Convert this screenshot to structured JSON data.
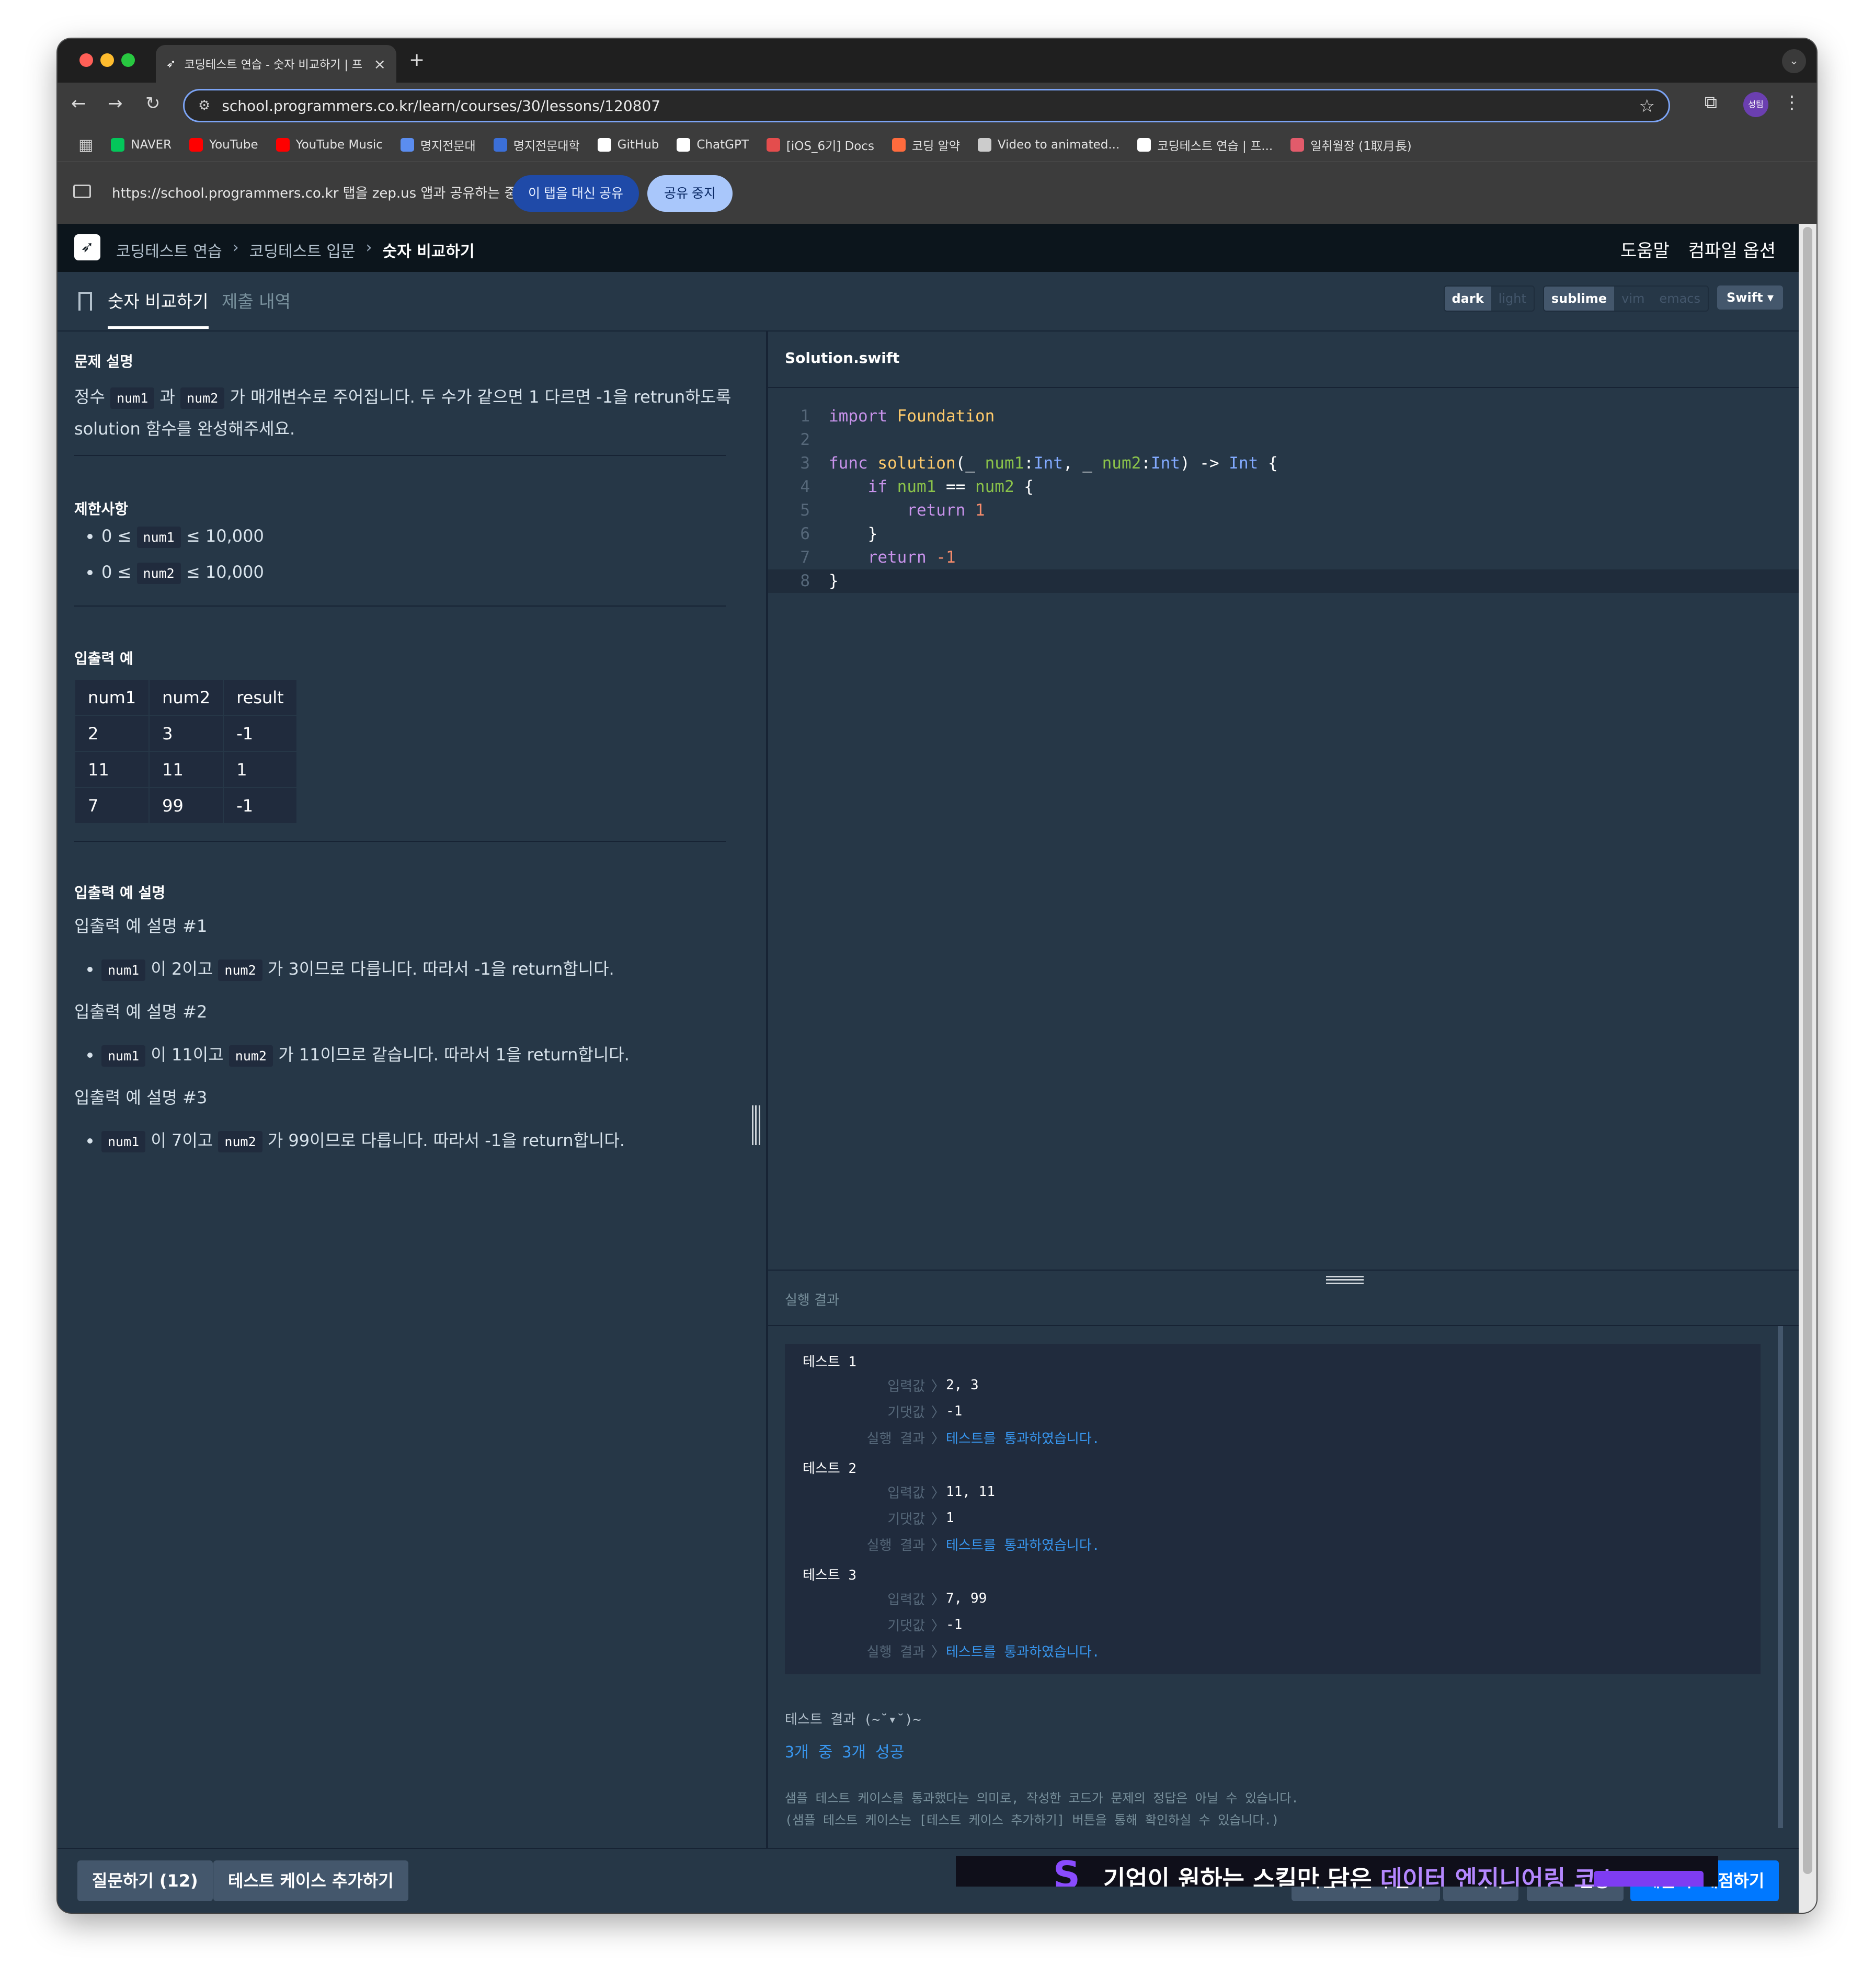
{
  "browser": {
    "tab_title": "코딩테스트 연습 - 숫자 비교하기 | 프",
    "url": "school.programmers.co.kr/learn/courses/30/lessons/120807",
    "profile_label": "성팀",
    "bookmarks": [
      {
        "label": "NAVER",
        "icon": "naver-icon",
        "color": "#03c75a"
      },
      {
        "label": "YouTube",
        "icon": "youtube-icon",
        "color": "#ff0000"
      },
      {
        "label": "YouTube Music",
        "icon": "youtube-music-icon",
        "color": "#ff0000"
      },
      {
        "label": "명지전문대",
        "icon": "doc-icon",
        "color": "#5b8def"
      },
      {
        "label": "명지전문대학",
        "icon": "sparkle-icon",
        "color": "#3b6fd8"
      },
      {
        "label": "GitHub",
        "icon": "github-icon",
        "color": "#ffffff"
      },
      {
        "label": "ChatGPT",
        "icon": "chatgpt-icon",
        "color": "#ffffff"
      },
      {
        "label": "[iOS_6기] Docs",
        "icon": "docs-icon",
        "color": "#e44d4d"
      },
      {
        "label": "코딩 알약",
        "icon": "pill-icon",
        "color": "#ff6b3d"
      },
      {
        "label": "Video to animated...",
        "icon": "video-icon",
        "color": "#cccccc"
      },
      {
        "label": "코딩테스트 연습 | 프...",
        "icon": "programmers-icon",
        "color": "#ffffff"
      },
      {
        "label": "일취월장 (1取月長)",
        "icon": "heart-icon",
        "color": "#e25b6b"
      }
    ]
  },
  "share": {
    "message": "https://school.programmers.co.kr 탭을 zep.us 앱과 공유하는 중",
    "share_this_tab": "이 탭을 대신 공유",
    "stop_sharing": "공유 중지"
  },
  "nav": {
    "breadcrumbs": [
      "코딩테스트 연습",
      "코딩테스트 입문",
      "숫자 비교하기"
    ],
    "help": "도움말",
    "compile_options": "컴파일 옵션"
  },
  "tabs": {
    "problem": "숫자 비교하기",
    "history": "제출 내역"
  },
  "editor_opts": {
    "theme": [
      "dark",
      "light"
    ],
    "keymap": [
      "sublime",
      "vim",
      "emacs"
    ],
    "language": "Swift"
  },
  "problem": {
    "desc_title": "문제 설명",
    "desc_pre": "정수",
    "desc_mid": "과",
    "desc_post": "가 매개변수로 주어집니다. 두 수가 같으면 1 다르면 -1을 retrun하도록",
    "desc_line2": "solution 함수를 완성해주세요.",
    "var1": "num1",
    "var2": "num2",
    "limits_title": "제한사항",
    "limit_lo": "0 ≤",
    "limit_hi": "≤ 10,000",
    "io_title": "입출력 예",
    "io_headers": [
      "num1",
      "num2",
      "result"
    ],
    "io_rows": [
      [
        "2",
        "3",
        "-1"
      ],
      [
        "11",
        "11",
        "1"
      ],
      [
        "7",
        "99",
        "-1"
      ]
    ],
    "explain_title": "입출력 예 설명",
    "explains": [
      {
        "title": "입출력 예 설명 #1",
        "a": "이 2이고",
        "b": "가 3이므로 다릅니다. 따라서 -1을 return합니다."
      },
      {
        "title": "입출력 예 설명 #2",
        "a": "이 11이고",
        "b": "가 11이므로 같습니다. 따라서 1을 return합니다."
      },
      {
        "title": "입출력 예 설명 #3",
        "a": "이 7이고",
        "b": "가 99이므로 다릅니다. 따라서 -1을 return합니다."
      }
    ]
  },
  "editor": {
    "filename": "Solution.swift",
    "line_numbers": [
      "1",
      "2",
      "3",
      "4",
      "5",
      "6",
      "7",
      "8"
    ]
  },
  "results": {
    "title": "실행 결과",
    "label_input": "입력값",
    "label_expected": "기댓값",
    "label_result": "실행 결과",
    "tests": [
      {
        "name": "테스트 1",
        "input": "2, 3",
        "expected": "-1",
        "result": "테스트를 통과하였습니다."
      },
      {
        "name": "테스트 2",
        "input": "11, 11",
        "expected": "1",
        "result": "테스트를 통과하였습니다."
      },
      {
        "name": "테스트 3",
        "input": "7, 99",
        "expected": "-1",
        "result": "테스트를 통과하였습니다."
      }
    ],
    "summary_title": "테스트 결과 (~˘▾˘)~",
    "summary": "3개 중 3개 성공",
    "note1": "샘플 테스트 케이스를 통과했다는 의미로, 작성한 코드가 문제의 정답은 아닐 수 있습니다.",
    "note2": "(샘플 테스트 케이스는 [테스트 케이스 추가하기] 버튼을 통해 확인하실 수 있습니다.)",
    "ad_text_a": "기업이 원하는 스킬만 담은 ",
    "ad_text_b": "데이터 엔지니어링 코스"
  },
  "bottom": {
    "ask": "질문하기 (12)",
    "add_testcase": "테스트 케이스 추가하기",
    "others": "다른 사람의 풀이",
    "reset": "초기화",
    "run": "코드 실행",
    "submit": "제출 후 채점하기"
  }
}
